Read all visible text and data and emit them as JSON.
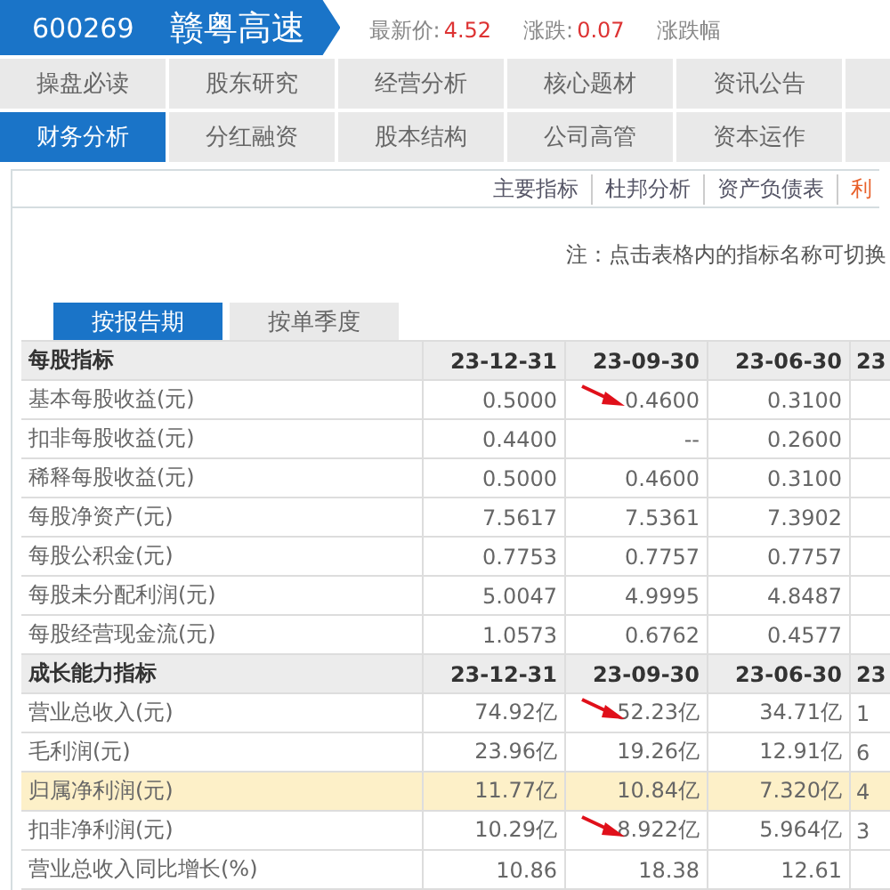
{
  "header": {
    "code": "600269",
    "name": "赣粤高速",
    "quotes": [
      {
        "label": "最新价:",
        "value": "4.52"
      },
      {
        "label": "涨跌:",
        "value": "0.07"
      },
      {
        "label": "涨跌幅"
      }
    ]
  },
  "nav": [
    [
      {
        "label": "操盘必读",
        "selected": false
      },
      {
        "label": "股东研究",
        "selected": false
      },
      {
        "label": "经营分析",
        "selected": false
      },
      {
        "label": "核心题材",
        "selected": false
      },
      {
        "label": "资讯公告",
        "selected": false
      },
      {
        "selected": false
      }
    ],
    [
      {
        "label": "财务分析",
        "selected": true
      },
      {
        "label": "分红融资",
        "selected": false
      },
      {
        "label": "股本结构",
        "selected": false
      },
      {
        "label": "公司高管",
        "selected": false
      },
      {
        "label": "资本运作",
        "selected": false
      },
      {
        "selected": false
      }
    ]
  ],
  "sub_links": [
    {
      "label": "主要指标",
      "selected": false
    },
    {
      "label": "杜邦分析",
      "selected": false
    },
    {
      "label": "资产负债表",
      "selected": false
    },
    {
      "label": "利",
      "selected": true
    }
  ],
  "note": "注：点击表格内的指标名称可切换",
  "period_tabs": [
    {
      "label": "按报告期",
      "selected": true
    },
    {
      "label": "按单季度",
      "selected": false
    }
  ],
  "sections": [
    {
      "title": "每股指标",
      "columns": [
        "23-12-31",
        "23-09-30",
        "23-06-30",
        "23"
      ],
      "rows": [
        {
          "label": "基本每股收益(元)",
          "highlighted": false,
          "cells": [
            {
              "text": "0.5000",
              "arrow": false
            },
            {
              "text": "0.4600",
              "arrow": true
            },
            {
              "text": "0.3100",
              "arrow": false
            }
          ]
        },
        {
          "label": "扣非每股收益(元)",
          "highlighted": false,
          "cells": [
            {
              "text": "0.4400",
              "arrow": false
            },
            {
              "text": "--",
              "arrow": false
            },
            {
              "text": "0.2600",
              "arrow": false
            }
          ]
        },
        {
          "label": "稀释每股收益(元)",
          "highlighted": false,
          "cells": [
            {
              "text": "0.5000",
              "arrow": false
            },
            {
              "text": "0.4600",
              "arrow": false
            },
            {
              "text": "0.3100",
              "arrow": false
            }
          ]
        },
        {
          "label": "每股净资产(元)",
          "highlighted": false,
          "cells": [
            {
              "text": "7.5617",
              "arrow": false
            },
            {
              "text": "7.5361",
              "arrow": false
            },
            {
              "text": "7.3902",
              "arrow": false
            }
          ]
        },
        {
          "label": "每股公积金(元)",
          "highlighted": false,
          "cells": [
            {
              "text": "0.7753",
              "arrow": false
            },
            {
              "text": "0.7757",
              "arrow": false
            },
            {
              "text": "0.7757",
              "arrow": false
            }
          ]
        },
        {
          "label": "每股未分配利润(元)",
          "highlighted": false,
          "cells": [
            {
              "text": "5.0047",
              "arrow": false
            },
            {
              "text": "4.9995",
              "arrow": false
            },
            {
              "text": "4.8487",
              "arrow": false
            }
          ]
        },
        {
          "label": "每股经营现金流(元)",
          "highlighted": false,
          "cells": [
            {
              "text": "1.0573",
              "arrow": false
            },
            {
              "text": "0.6762",
              "arrow": false
            },
            {
              "text": "0.4577",
              "arrow": false
            }
          ]
        }
      ]
    },
    {
      "title": "成长能力指标",
      "columns": [
        "23-12-31",
        "23-09-30",
        "23-06-30",
        "23"
      ],
      "rows": [
        {
          "label": "营业总收入(元)",
          "highlighted": false,
          "cells": [
            {
              "text": "74.92亿",
              "arrow": false
            },
            {
              "text": "52.23亿",
              "arrow": true
            },
            {
              "text": "34.71亿",
              "arrow": false
            },
            {
              "text": "1",
              "arrow": false
            }
          ]
        },
        {
          "label": "毛利润(元)",
          "highlighted": false,
          "cells": [
            {
              "text": "23.96亿",
              "arrow": false
            },
            {
              "text": "19.26亿",
              "arrow": false
            },
            {
              "text": "12.91亿",
              "arrow": false
            },
            {
              "text": "6",
              "arrow": false
            }
          ]
        },
        {
          "label": "归属净利润(元)",
          "highlighted": true,
          "cells": [
            {
              "text": "11.77亿",
              "arrow": false
            },
            {
              "text": "10.84亿",
              "arrow": false
            },
            {
              "text": "7.320亿",
              "arrow": false
            },
            {
              "text": "4",
              "arrow": false
            }
          ]
        },
        {
          "label": "扣非净利润(元)",
          "highlighted": false,
          "cells": [
            {
              "text": "10.29亿",
              "arrow": false
            },
            {
              "text": "8.922亿",
              "arrow": true
            },
            {
              "text": "5.964亿",
              "arrow": false
            },
            {
              "text": "3",
              "arrow": false
            }
          ]
        },
        {
          "label": "营业总收入同比增长(%)",
          "highlighted": false,
          "cells": [
            {
              "text": "10.86",
              "arrow": false
            },
            {
              "text": "18.38",
              "arrow": false
            },
            {
              "text": "12.61",
              "arrow": false
            }
          ]
        }
      ]
    }
  ]
}
